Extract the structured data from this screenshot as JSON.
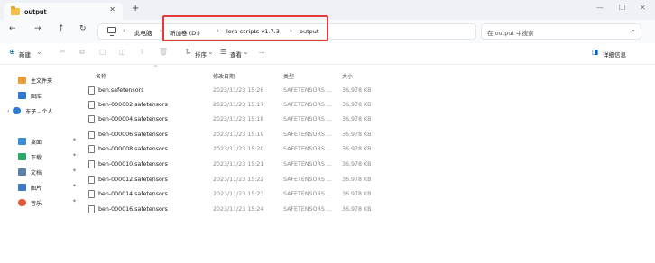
{
  "tab": {
    "title": "output",
    "close": "✕",
    "new": "+"
  },
  "window": {
    "minimize": "—",
    "maximize": "☐",
    "close": "✕"
  },
  "nav": {
    "back": "←",
    "forward": "→",
    "up": "↑",
    "refresh": "↻"
  },
  "address": {
    "breadcrumbs": [
      "此电脑",
      "新加卷 (D:)",
      "lora-scripts-v1.7.3",
      "output"
    ],
    "separator": "›"
  },
  "search": {
    "placeholder": "在 output 中搜索",
    "icon": "search-icon"
  },
  "toolbar": {
    "new_label": "新建",
    "sort_label": "排序",
    "view_label": "查看",
    "more_label": "···",
    "details_label": "详细信息"
  },
  "sidebar": {
    "items": [
      {
        "label": "主文件夹",
        "icon": "home-icon"
      },
      {
        "label": "图库",
        "icon": "gallery-icon"
      },
      {
        "label": "东子 - 个人",
        "icon": "onedrive-icon"
      },
      {
        "label": "桌面",
        "icon": "desktop-icon",
        "pinned": true
      },
      {
        "label": "下载",
        "icon": "download-icon",
        "pinned": true
      },
      {
        "label": "文档",
        "icon": "documents-icon",
        "pinned": true
      },
      {
        "label": "图片",
        "icon": "pictures-icon",
        "pinned": true
      },
      {
        "label": "音乐",
        "icon": "music-icon",
        "pinned": true
      }
    ]
  },
  "columns": {
    "name": "名称",
    "date": "修改日期",
    "type": "类型",
    "size": "大小"
  },
  "files": [
    {
      "name": "ben.safetensors",
      "date": "2023/11/23 15:26",
      "type": "SAFETENSORS ...",
      "size": "36,978 KB"
    },
    {
      "name": "ben-000002.safetensors",
      "date": "2023/11/23 15:17",
      "type": "SAFETENSORS ...",
      "size": "36,978 KB"
    },
    {
      "name": "ben-000004.safetensors",
      "date": "2023/11/23 15:18",
      "type": "SAFETENSORS ...",
      "size": "36,978 KB"
    },
    {
      "name": "ben-000006.safetensors",
      "date": "2023/11/23 15:19",
      "type": "SAFETENSORS ...",
      "size": "36,978 KB"
    },
    {
      "name": "ben-000008.safetensors",
      "date": "2023/11/23 15:20",
      "type": "SAFETENSORS ...",
      "size": "36,978 KB"
    },
    {
      "name": "ben-000010.safetensors",
      "date": "2023/11/23 15:21",
      "type": "SAFETENSORS ...",
      "size": "36,978 KB"
    },
    {
      "name": "ben-000012.safetensors",
      "date": "2023/11/23 15:22",
      "type": "SAFETENSORS ...",
      "size": "36,978 KB"
    },
    {
      "name": "ben-000014.safetensors",
      "date": "2023/11/23 15:23",
      "type": "SAFETENSORS ...",
      "size": "36,978 KB"
    },
    {
      "name": "ben-000016.safetensors",
      "date": "2023/11/23 15:24",
      "type": "SAFETENSORS ...",
      "size": "36,978 KB"
    }
  ],
  "colors": {
    "highlight": "#e43a3a",
    "folder": "#f3c04a",
    "accent": "#0067c0"
  }
}
